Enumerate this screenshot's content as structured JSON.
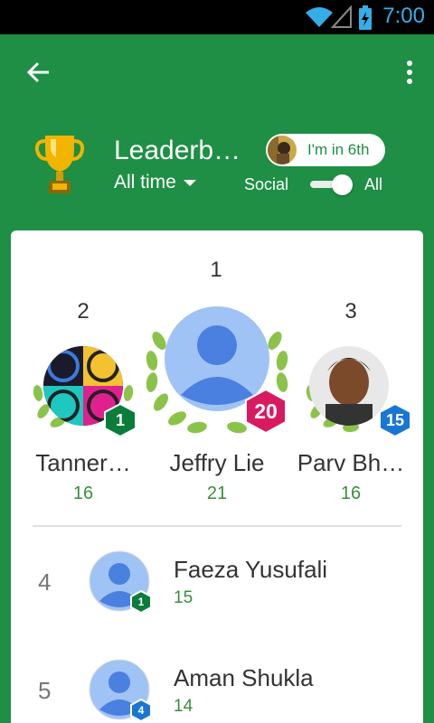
{
  "status_bar": {
    "time": "7:00"
  },
  "header": {
    "title": "Leaderb…",
    "time_filter": "All time",
    "rank_chip": "I'm in 6th",
    "toggle_left": "Social",
    "toggle_right": "All"
  },
  "podium": [
    {
      "rank": "1",
      "name": "Jeffry Lie",
      "score": "21",
      "level": "20"
    },
    {
      "rank": "2",
      "name": "Tanner…",
      "score": "16",
      "level": "1"
    },
    {
      "rank": "3",
      "name": "Parv Bh…",
      "score": "16",
      "level": "15"
    }
  ],
  "rows": [
    {
      "rank": "4",
      "name": "Faeza Yusufali",
      "score": "15",
      "level": "1"
    },
    {
      "rank": "5",
      "name": "Aman Shukla",
      "score": "14",
      "level": "4"
    }
  ],
  "colors": {
    "primary_green": "#1e8f45",
    "score_green": "#388e3c",
    "level_pink": "#d81b60",
    "level_blue": "#1976d2",
    "level_green": "#0b7d3b",
    "avatar_blue": "#9fc3f5"
  },
  "icons": {
    "back": "back-arrow-icon",
    "more": "more-vert-icon",
    "trophy": "trophy-icon",
    "dropdown": "dropdown-caret-icon",
    "wifi": "wifi-icon",
    "signal": "signal-icon",
    "battery": "battery-icon"
  }
}
